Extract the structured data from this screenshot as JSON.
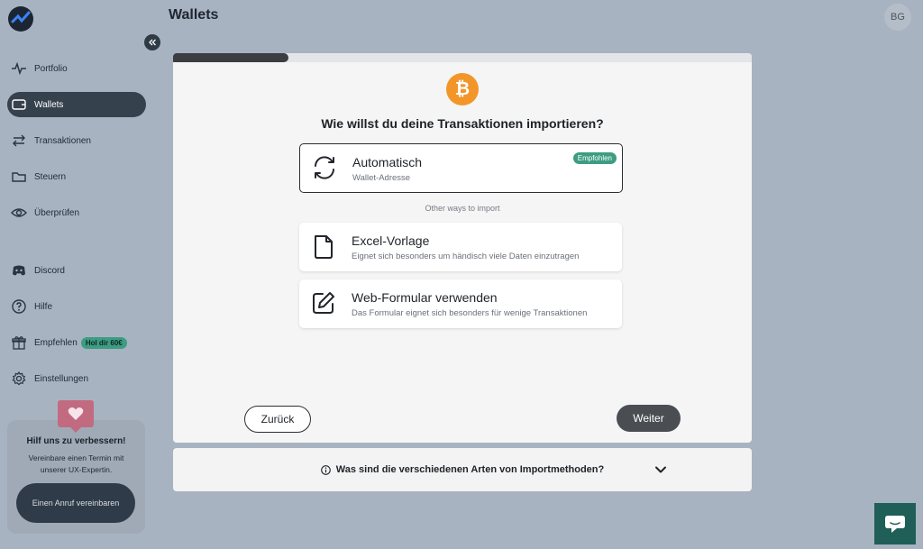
{
  "header": {
    "title": "Wallets",
    "avatar_initials": "BG"
  },
  "sidebar": {
    "items": [
      {
        "label": "Portfolio",
        "icon": "activity-icon"
      },
      {
        "label": "Wallets",
        "icon": "wallet-icon",
        "active": true
      },
      {
        "label": "Transaktionen",
        "icon": "transfer-arrows-icon"
      },
      {
        "label": "Steuern",
        "icon": "folder-icon"
      },
      {
        "label": "Überprüfen",
        "icon": "eye-icon"
      },
      {
        "label": "Discord",
        "icon": "discord-icon"
      },
      {
        "label": "Hilfe",
        "icon": "help-circle-icon"
      },
      {
        "label": "Empfehlen",
        "icon": "gift-icon",
        "badge": "Hol dir 60€"
      },
      {
        "label": "Einstellungen",
        "icon": "gear-icon"
      }
    ],
    "help_card": {
      "title": "Hilf uns zu verbessern!",
      "text": "Vereinbare einen Termin mit unserer UX-Expertin.",
      "button": "Einen Anruf vereinbaren"
    }
  },
  "import": {
    "progress": 0.2,
    "question": "Wie willst du deine Transaktionen importieren?",
    "options": [
      {
        "title": "Automatisch",
        "subtitle": "Wallet-Adresse",
        "badge": "Empfohlen",
        "selected": true,
        "icon": "sync-icon"
      },
      {
        "title": "Excel-Vorlage",
        "subtitle": "Eignet sich besonders um händisch viele Daten einzutragen",
        "icon": "file-icon"
      },
      {
        "title": "Web-Formular verwenden",
        "subtitle": "Das Formular eignet sich besonders für wenige Transaktionen",
        "icon": "edit-icon"
      }
    ],
    "other_ways": "Other ways to import",
    "back_label": "Zurück",
    "next_label": "Weiter"
  },
  "faq": {
    "question": "Was sind die verschiedenen Arten von Importmethoden?"
  },
  "colors": {
    "accent_green": "#3d9c82",
    "bitcoin_orange": "#f2962a",
    "dark": "#36414e",
    "chat": "#1f5f57"
  }
}
